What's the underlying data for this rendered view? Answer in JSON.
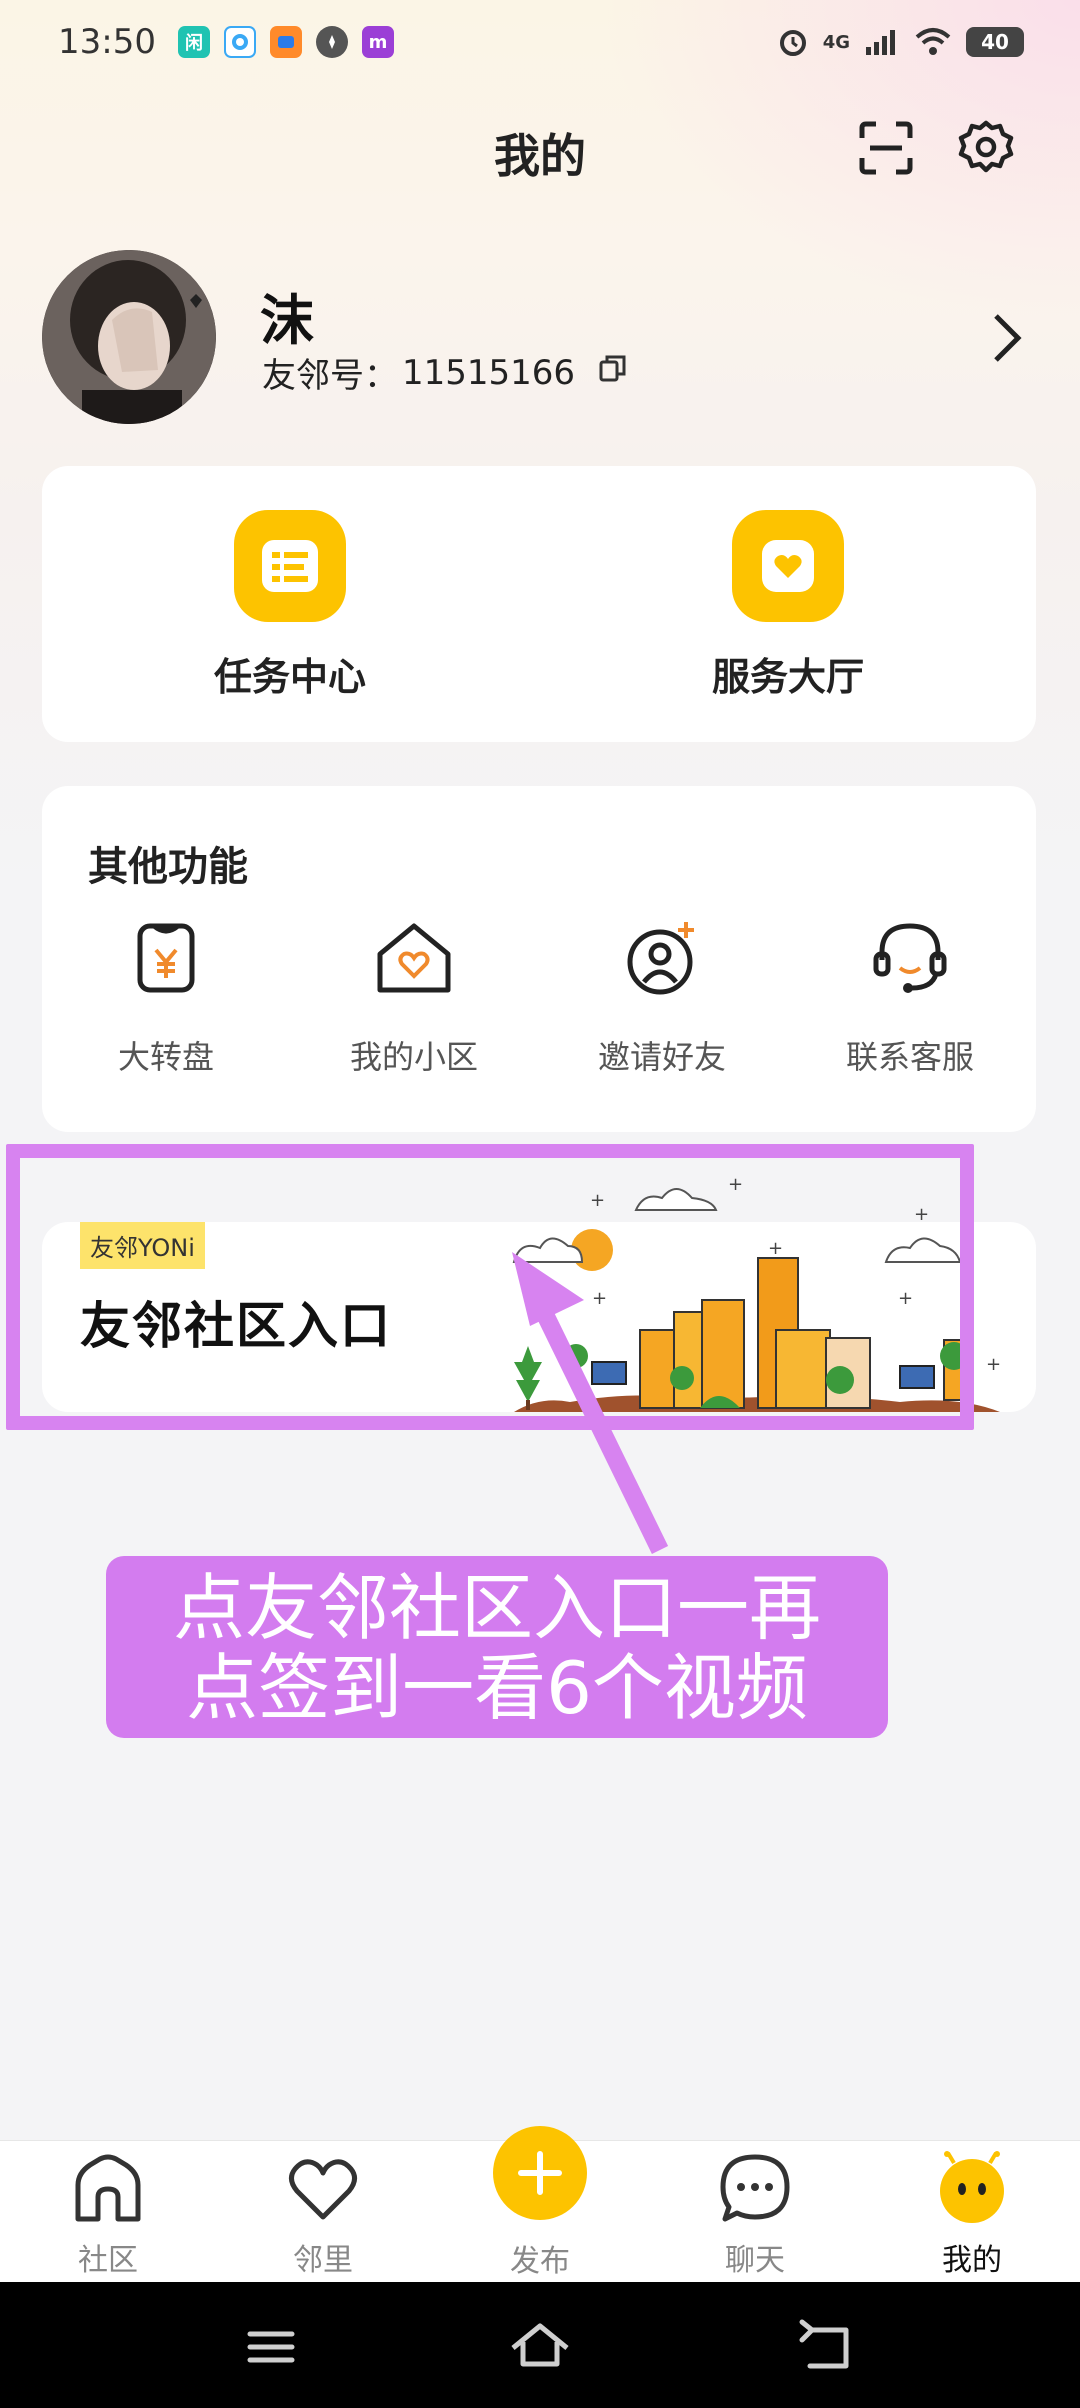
{
  "status_bar": {
    "time": "13:50",
    "notifications": [
      "闲",
      "qq-icon",
      "app-icon",
      "compass-icon",
      "m"
    ],
    "network": "4G",
    "battery": "40"
  },
  "header": {
    "title": "我的"
  },
  "profile": {
    "name": "沫",
    "uid_label": "友邻号：",
    "uid_value": "11515166"
  },
  "features": [
    {
      "label": "任务中心",
      "icon": "task-list-icon"
    },
    {
      "label": "服务大厅",
      "icon": "heart-shield-icon"
    }
  ],
  "other_functions": {
    "title": "其他功能",
    "items": [
      {
        "label": "大转盘",
        "icon": "yen-bag-icon"
      },
      {
        "label": "我的小区",
        "icon": "home-heart-icon"
      },
      {
        "label": "邀请好友",
        "icon": "add-friend-icon"
      },
      {
        "label": "联系客服",
        "icon": "headset-icon"
      }
    ]
  },
  "banner": {
    "tag": "友邻YONi",
    "title": "友邻社区入口"
  },
  "annotation": {
    "line1": "点友邻社区入口一再",
    "line2": "点签到一看6个视频"
  },
  "bottom_nav": {
    "items": [
      {
        "label": "社区",
        "icon": "community-home-icon"
      },
      {
        "label": "邻里",
        "icon": "heart-icon"
      },
      {
        "label": "发布",
        "icon": "plus-icon"
      },
      {
        "label": "聊天",
        "icon": "chat-bubble-icon"
      },
      {
        "label": "我的",
        "icon": "mascot-icon",
        "active": true
      }
    ]
  },
  "colors": {
    "accent": "#fdc300",
    "annotation": "#d783f0",
    "background": "#f4f4f6"
  }
}
